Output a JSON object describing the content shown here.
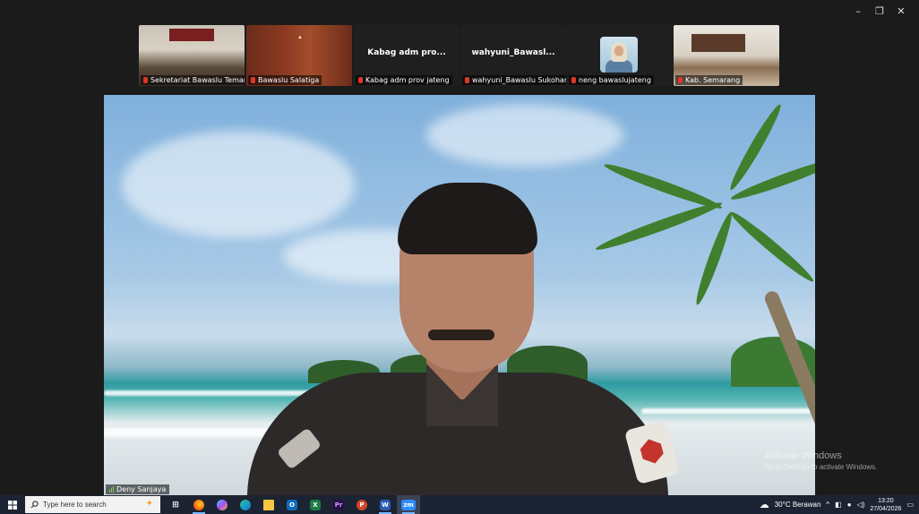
{
  "window": {
    "minimize": "–",
    "restore": "❐",
    "close": "✕"
  },
  "participants": [
    {
      "name": "Sekretariat Bawaslu Temanggung"
    },
    {
      "name": "Bawaslu Salatiga"
    },
    {
      "name": "Kabag adm prov jateng",
      "display": "Kabag adm pro..."
    },
    {
      "name": "wahyuni_Bawaslu Sukoharjo",
      "display": "wahyuni_Bawasl..."
    },
    {
      "name": "neng bawaslujateng"
    },
    {
      "name": "Kab. Semarang"
    }
  ],
  "main_video": {
    "speaker_name": "Deny Sanjaya"
  },
  "watermark": {
    "line1": "Activate Windows",
    "line2": "Go to Settings to activate Windows."
  },
  "taskbar": {
    "search_placeholder": "Type here to search",
    "apps": [
      {
        "icon": "task-view-icon",
        "label": "⊞"
      },
      {
        "icon": "firefox-icon",
        "label": ""
      },
      {
        "icon": "copilot-icon",
        "label": ""
      },
      {
        "icon": "edge-icon",
        "label": ""
      },
      {
        "icon": "file-explorer-icon",
        "label": ""
      },
      {
        "icon": "outlook-icon",
        "label": "O"
      },
      {
        "icon": "excel-icon",
        "label": "X"
      },
      {
        "icon": "premiere-icon",
        "label": "Pr"
      },
      {
        "icon": "powerpoint-icon",
        "label": "P"
      },
      {
        "icon": "word-icon",
        "label": "W"
      },
      {
        "icon": "zoom-icon",
        "label": "zm"
      }
    ],
    "weather": "30°C  Berawan",
    "time": "13:20",
    "date": "27/04/2026"
  },
  "colors": {
    "mic_muted": "#e0352b",
    "taskbar": "#1c2332",
    "zoom_blue": "#2d8cff"
  }
}
